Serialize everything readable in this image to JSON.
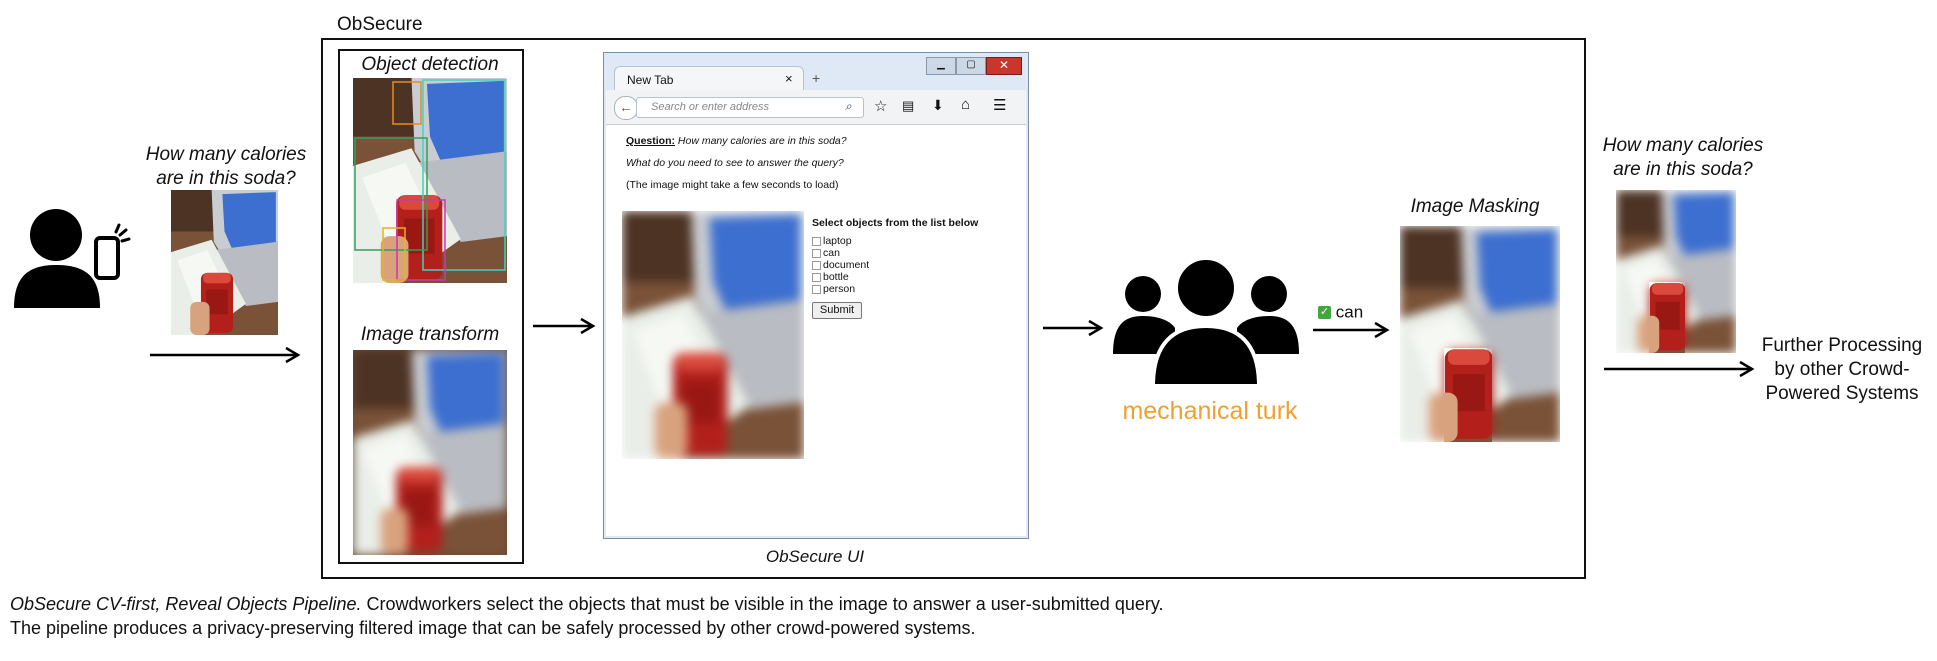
{
  "left_query": {
    "line1": "How many calories",
    "line2": "are in this soda?"
  },
  "right_query": {
    "line1": "How many calories",
    "line2": "are in this soda?"
  },
  "pipeline_label": "ObSecure",
  "cv_panel": {
    "detection_title": "Object detection",
    "transform_title": "Image transform"
  },
  "browser": {
    "tab_label": "New Tab",
    "address_placeholder": "Search or enter address",
    "question_label": "Question:",
    "question_text": "How many calories are in this soda?",
    "prompt_text": "What do you need to see to answer the query?",
    "loading_note": "(The image might take a few seconds to load)",
    "select_heading": "Select objects from the list below",
    "options": [
      "laptop",
      "can",
      "document",
      "bottle",
      "person"
    ],
    "submit_label": "Submit"
  },
  "ui_caption": "ObSecure UI",
  "turk": {
    "label": "mechanical turk",
    "selected_option": "can"
  },
  "masking_title": "Image Masking",
  "further_processing": {
    "line1": "Further Processing",
    "line2": "by other Crowd-",
    "line3": "Powered Systems"
  },
  "caption": {
    "lead": "ObSecure CV-first, Reveal Objects Pipeline.",
    "rest": " Crowdworkers select the objects that must be visible in the image to answer a user-submitted query.",
    "line2": "The pipeline produces a privacy-preserving filtered image that can be safely processed by other crowd-powered systems."
  },
  "colors": {
    "turk_orange": "#f0a030",
    "check_green": "#3ea83a",
    "can_red": "#b3201c",
    "laptop_blue": "#3b6fd8"
  }
}
